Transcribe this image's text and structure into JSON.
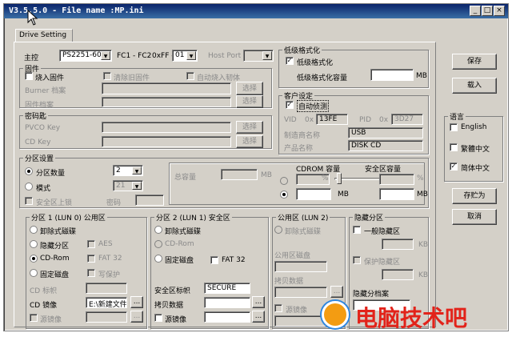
{
  "window": {
    "title": "V3.5.5.0 - File name :MP.ini"
  },
  "tab": "Drive Setting",
  "controller": {
    "label": "主控",
    "model": "PS2251-60",
    "fc_label": "FC1 - FC2",
    "fc_prefix": "0xFF -",
    "fc_value": "01",
    "host_port_label": "Host Port"
  },
  "firmware": {
    "title": "固件",
    "burn_label": "烧入固件",
    "clear_label": "清除旧固件",
    "auto_label": "自动烧入韧体",
    "burner_label": "Burner 档案",
    "fw_file_label": "固件档案",
    "browse": "选择"
  },
  "password": {
    "title": "密码匙",
    "pvco_label": "PVCO Key",
    "cd_label": "CD Key",
    "browse": "选择"
  },
  "lowformat": {
    "title": "低级格式化",
    "check_label": "低级格式化",
    "capacity_label": "低级格式化容量",
    "unit": "MB"
  },
  "customer": {
    "title": "客户设定",
    "auto_detect": "自动侦测",
    "vid_label": "VID",
    "vid_prefix": "0x",
    "vid_value": "13FE",
    "pid_label": "PID",
    "pid_prefix": "0x",
    "pid_value": "3D27",
    "vendor_label": "制造商名称",
    "vendor_value": "USB",
    "product_label": "产品名称",
    "product_value": "DISK CD"
  },
  "partition": {
    "title": "分区设置",
    "count_label": "分区数量",
    "count_value": "2",
    "mode_label": "模式",
    "mode_value": "21",
    "lock_label": "安全区上锁",
    "pwd_label": "密码",
    "total_label": "总容量",
    "mb": "MB",
    "cdrom_cap_label": "CDROM 容量",
    "secure_cap_label": "安全区容量",
    "pct": "%"
  },
  "part1": {
    "title": "分区 1 (LUN 0) 公用区",
    "removable": "卸除式磁碟",
    "hidden": "隐藏分区",
    "aes": "AES",
    "cdrom": "CD-Rom",
    "fat32": "FAT 32",
    "fixed": "固定磁盘",
    "write_protect": "写保护",
    "cd_label_label": "CD 标帜",
    "cd_image_label": "CD 镜像",
    "cd_image_value": "E:\\新建文件夹",
    "source_image_label": "源镜像",
    "browse": "..."
  },
  "part2": {
    "title": "分区 2 (LUN 1) 安全区",
    "removable": "卸除式磁碟",
    "cdrom": "CD-Rom",
    "fixed": "固定磁盘",
    "fat32": "FAT 32",
    "secure_label_label": "安全区标帜",
    "secure_label_value": "SECURE",
    "copy_data_label": "拷贝数据",
    "source_image_label": "源镜像",
    "browse": "..."
  },
  "public": {
    "title": "公用区 (LUN 2)",
    "removable": "卸除式磁碟",
    "pub_disk_label": "公用区磁盘",
    "copy_data_label": "拷贝数据",
    "source_image_label": "源镜像",
    "browse": "..."
  },
  "hidden": {
    "title": "隐藏分区",
    "normal_label": "一般隐藏区",
    "protect_label": "保护隐藏区",
    "kb": "KB",
    "archive_label": "隐藏分档案"
  },
  "buttons": {
    "save": "保存",
    "load": "载入",
    "save_as": "存贮为",
    "cancel": "取消"
  },
  "language": {
    "title": "语言",
    "english": "English",
    "traditional": "繁體中文",
    "simplified": "简体中文"
  },
  "watermark": "电脑技术吧"
}
